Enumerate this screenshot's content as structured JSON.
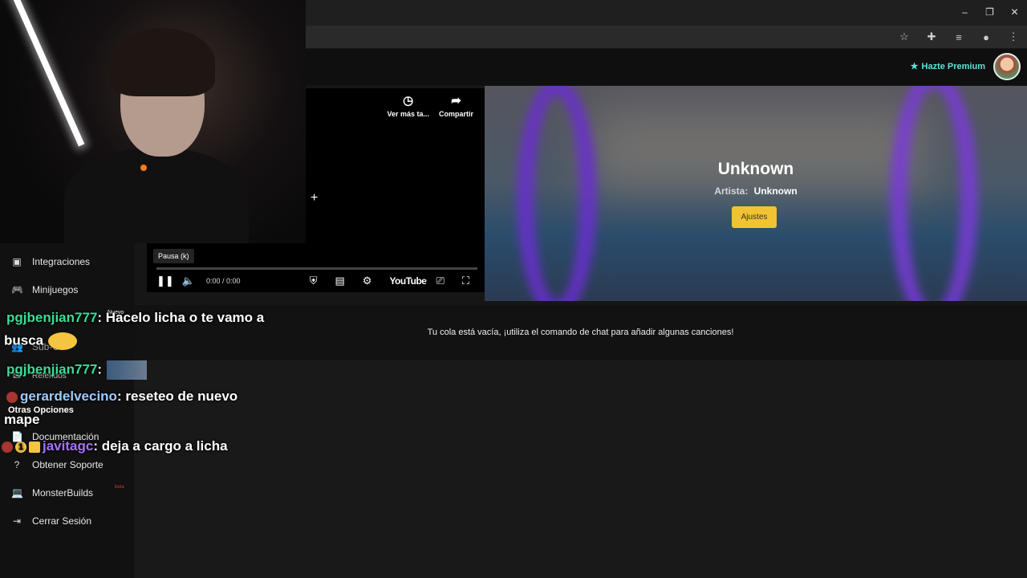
{
  "window": {
    "minimize_icon": "minimize-icon",
    "restore_icon": "restore-icon",
    "close_icon": "close-icon",
    "minimize": "–",
    "restore": "❐",
    "close": "✕"
  },
  "toolbar": {
    "icons": [
      "star-icon",
      "extensions-icon",
      "media-icon",
      "profile-icon",
      "menu-icon"
    ],
    "glyphs": [
      "☆",
      "✚",
      "≡",
      "●",
      "⋮"
    ]
  },
  "header": {
    "premium_label": "Hazte Premium",
    "premium_icon": "★"
  },
  "player": {
    "actions": [
      {
        "label": "Ver más ta...",
        "icon": "◷"
      },
      {
        "label": "Compartir",
        "icon": "➦"
      }
    ],
    "tooltip": "Pausa (k)",
    "time": "0:00 / 0:00",
    "pause_icon": "❚❚",
    "volume_icon": "🔈",
    "shield_icon": "⛨",
    "subtitles_icon": "▤",
    "settings_icon": "⚙",
    "logo": "YouTube",
    "cast_icon": "⎚",
    "fullscreen_icon": "⛶",
    "crosshair": "+"
  },
  "song": {
    "title": "Unknown",
    "artist_label": "Artista:",
    "artist": "Unknown",
    "settings_button": "Ajustes"
  },
  "queue": {
    "empty_message": "Tu cola está vacía, ¡utiliza el comando de chat para añadir algunas canciones!"
  },
  "sidebar": {
    "items": [
      {
        "label": "Integraciones",
        "icon": "▣"
      },
      {
        "label": "Minijuegos",
        "icon": "🎮"
      },
      {
        "label": "Sub-Us",
        "icon": "👥"
      },
      {
        "label": "Referidos",
        "icon": "✉"
      }
    ],
    "other_heading": "Otras Opciones",
    "other_items": [
      {
        "label": "Documentación",
        "icon": "📄"
      },
      {
        "label": "Obtener Soporte",
        "icon": "?"
      },
      {
        "label": "MonsterBuilds",
        "icon": "💻"
      },
      {
        "label": "Cerrar Sesión",
        "icon": "⇥"
      }
    ],
    "new_tag": "Nuevo",
    "red_tag": "beta"
  },
  "chat": [
    {
      "user": "pgjbenjian777",
      "message": ": Hacelo licha o te vamo a",
      "continuation": "busca"
    },
    {
      "user": "pgjbenjian777",
      "message": ":"
    },
    {
      "user": "gerardelvecino",
      "message": ": reseteo de nuevo",
      "continuation": "mape"
    },
    {
      "badge": "1",
      "user": "javitagc",
      "message": ": deja a cargo a licha"
    }
  ]
}
